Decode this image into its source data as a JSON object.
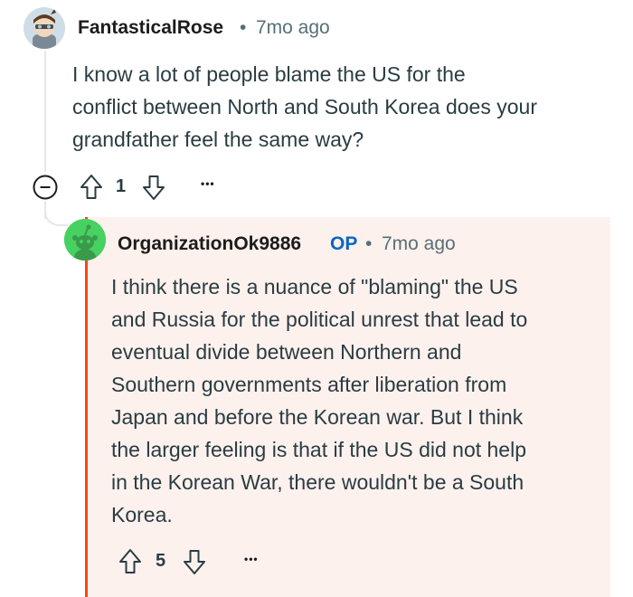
{
  "comment1": {
    "username": "FantasticalRose",
    "separator": "•",
    "time": "7mo ago",
    "body_lines": [
      "I know a lot of people blame the US for the",
      "conflict between North and South Korea does your",
      "grandfather feel the same way?"
    ],
    "vote_count": "1",
    "more_label": "•••"
  },
  "comment2": {
    "username": "OrganizationOk9886",
    "op_badge": "OP",
    "separator": "•",
    "time": "7mo ago",
    "body_lines": [
      "I think there is a nuance of \"blaming\" the US",
      "and Russia for the political unrest that lead to",
      "eventual divide between Northern and",
      "Southern governments after liberation from",
      "Japan and before the Korean war. But I think",
      "the larger feeling is that if the US did not help",
      "in the Korean War, there wouldn't be a South",
      "Korea."
    ],
    "vote_count": "5",
    "more_label": "•••"
  },
  "colors": {
    "accent": "#ff4500",
    "op_blue": "#0a66c2",
    "highlight_bg": "#fdf1ee",
    "meta_gray": "#576f76"
  },
  "icons": {
    "collapse": "minus-circle-icon",
    "upvote": "arrow-up-icon",
    "downvote": "arrow-down-icon",
    "more": "ellipsis-icon"
  }
}
